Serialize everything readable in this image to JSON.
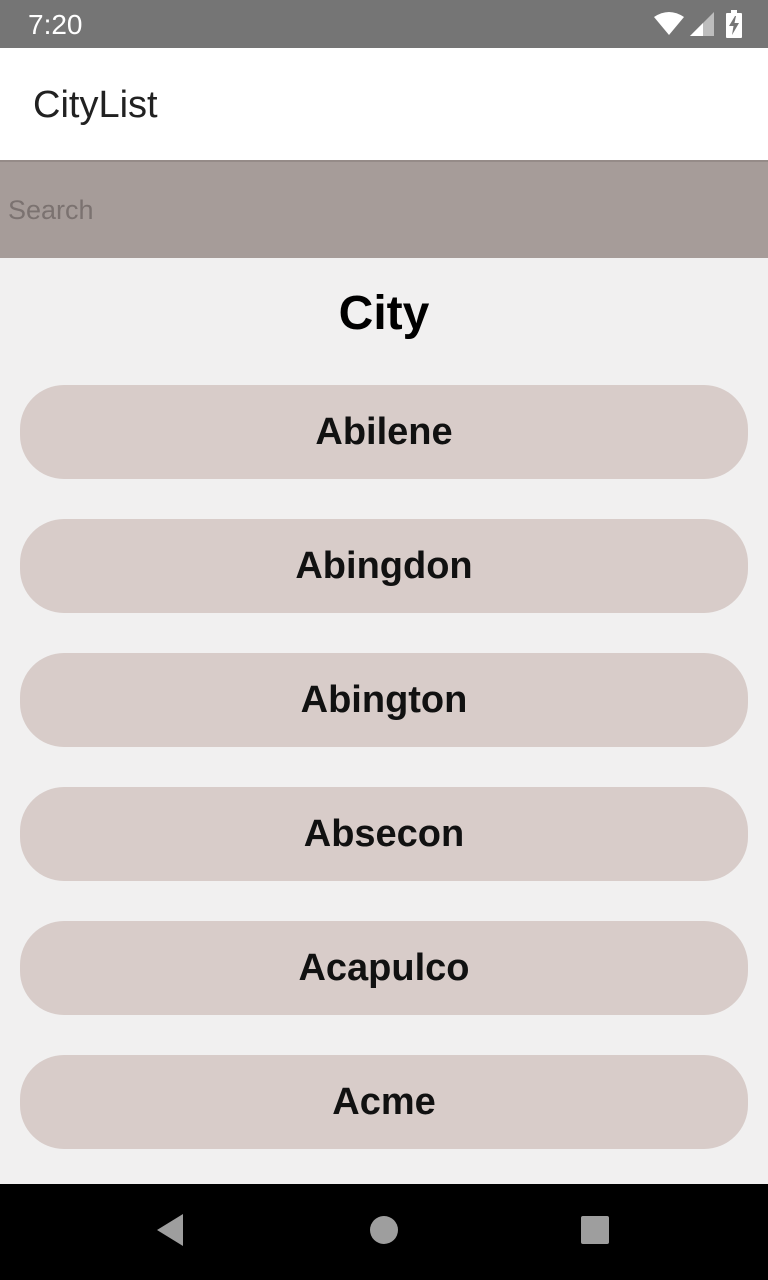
{
  "status_bar": {
    "time": "7:20",
    "icons": [
      "wifi-icon",
      "cell-signal-icon",
      "battery-charging-icon"
    ]
  },
  "app_bar": {
    "title": "CityList"
  },
  "search": {
    "placeholder": "Search",
    "value": ""
  },
  "list": {
    "heading": "City",
    "items": [
      {
        "label": "Abilene"
      },
      {
        "label": "Abingdon"
      },
      {
        "label": "Abington"
      },
      {
        "label": "Absecon"
      },
      {
        "label": "Acapulco"
      },
      {
        "label": "Acme"
      }
    ]
  },
  "nav_bar": {
    "buttons": [
      "back-icon",
      "home-icon",
      "recents-icon"
    ]
  },
  "colors": {
    "status_bar": "#757575",
    "app_bar": "#ffffff",
    "search_bar": "#a69c99",
    "background": "#f1f0f0",
    "city_button": "#d8ccc9",
    "nav_bar": "#000000"
  }
}
